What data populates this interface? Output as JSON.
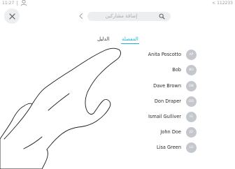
{
  "status_bar": {
    "time": "11:27",
    "extension": "< 112233",
    "person_icon": "person-icon"
  },
  "header": {
    "close_icon": "close-icon",
    "back_icon": "chevron-left-icon",
    "search_placeholder": "إضافة مشاركين",
    "search_icon": "search-icon"
  },
  "tabs": {
    "favorites_label": "المفضلة",
    "directory_label": "الدليل",
    "active": "favorites",
    "accent_color": "#1fb2d2"
  },
  "contacts": [
    {
      "name": "Anita Poscotto",
      "initials": "AP"
    },
    {
      "name": "Bob",
      "initials": "BO"
    },
    {
      "name": "Dave Brown",
      "initials": "DB"
    },
    {
      "name": "Don Draper",
      "initials": "DD"
    },
    {
      "name": "Ismail Gulliver",
      "initials": "IG"
    },
    {
      "name": "John Doe",
      "initials": "JD"
    },
    {
      "name": "Lisa Green",
      "initials": "LG"
    }
  ],
  "overlay": {
    "type": "tap gesture hand",
    "icon": "hand-pointer-icon"
  }
}
